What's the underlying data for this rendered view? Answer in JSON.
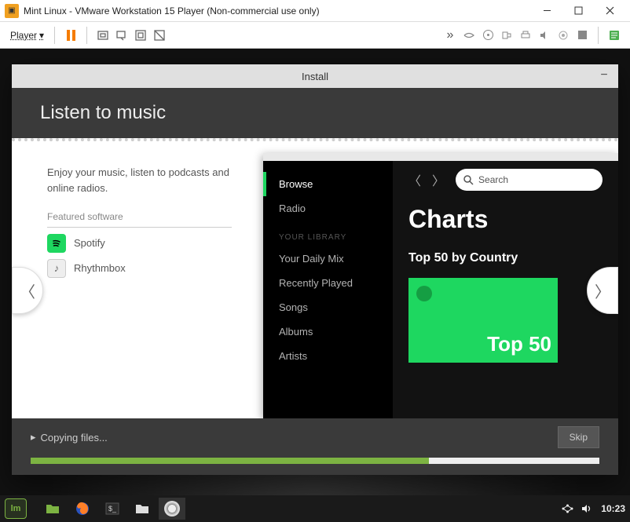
{
  "vmware": {
    "title": "Mint Linux - VMware Workstation 15 Player (Non-commercial use only)",
    "player_label": "Player"
  },
  "install": {
    "window_title": "Install",
    "header": "Listen to music",
    "intro": "Enjoy your music, listen to podcasts and online radios.",
    "featured_label": "Featured software",
    "software": [
      {
        "name": "Spotify",
        "icon": "spotify"
      },
      {
        "name": "Rhythmbox",
        "icon": "rhythmbox"
      }
    ],
    "status": "Copying files...",
    "skip_label": "Skip",
    "progress_pct": 70
  },
  "spotify": {
    "sidebar": {
      "items_top": [
        "Browse",
        "Radio"
      ],
      "library_header": "YOUR LIBRARY",
      "items_lib": [
        "Your Daily Mix",
        "Recently Played",
        "Songs",
        "Albums",
        "Artists"
      ]
    },
    "search_placeholder": "Search",
    "main_title": "Charts",
    "sub_title": "Top 50 by Country",
    "card_text": "Top 50"
  },
  "taskbar": {
    "clock": "10:23"
  }
}
